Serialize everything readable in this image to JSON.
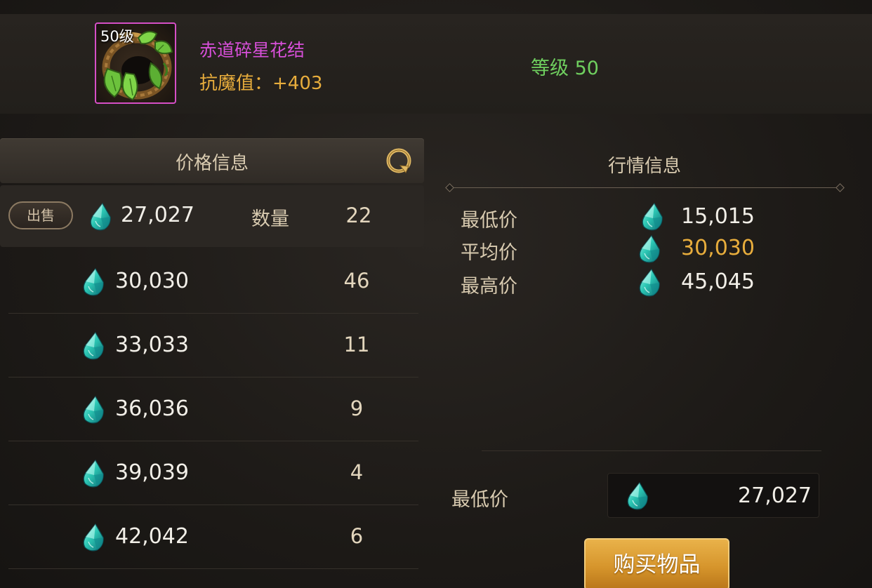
{
  "item": {
    "level_badge": "50级",
    "name": "赤道碎星花结",
    "stat": "抗魔值：+403",
    "level_text": "等级 50"
  },
  "price_panel": {
    "title": "价格信息",
    "first_listing": {
      "sell_label": "出售",
      "price": "27,027",
      "quantity_label": "数量",
      "quantity": "22"
    },
    "listings": [
      {
        "price": "30,030",
        "quantity": "46"
      },
      {
        "price": "33,033",
        "quantity": "11"
      },
      {
        "price": "36,036",
        "quantity": "9"
      },
      {
        "price": "39,039",
        "quantity": "4"
      },
      {
        "price": "42,042",
        "quantity": "6"
      }
    ]
  },
  "market_panel": {
    "title": "行情信息",
    "stats": [
      {
        "label": "最低价",
        "value": "15,015"
      },
      {
        "label": "平均价",
        "value": "30,030"
      },
      {
        "label": "最高价",
        "value": "45,045"
      }
    ],
    "min_price_label": "最低价",
    "min_price_value": "27,027",
    "buy_label": "购买物品"
  },
  "icons": {
    "currency": "gem-icon",
    "refresh": "refresh-icon"
  },
  "colors": {
    "item_name": "#d64fd8",
    "item_stat": "#e8ad3c",
    "level": "#6fcf5f",
    "average_price": "#e8ad3c",
    "buy_button": "#d6952c"
  }
}
